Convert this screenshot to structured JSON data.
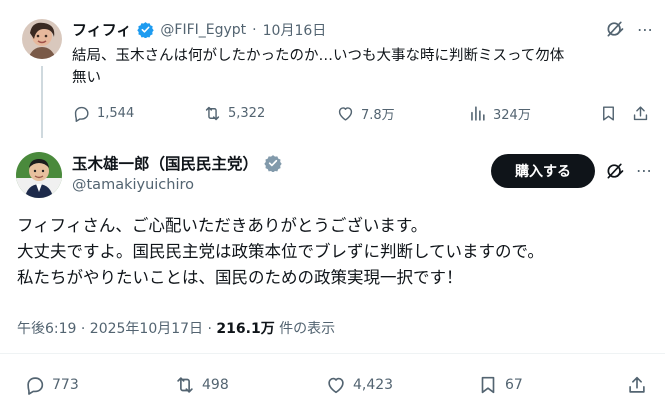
{
  "tweet1": {
    "name": "フィフィ",
    "handle": "@FIFI_Egypt",
    "sep": "·",
    "date": "10月16日",
    "text_line1": "結局、玉木さんは何がしたかったのか…いつも大事な時に判断ミスって勿体",
    "text_line2": "無い",
    "replies": "1,544",
    "reposts": "5,322",
    "likes": "7.8万",
    "views": "324万"
  },
  "tweet2": {
    "name": "玉木雄一郎（国民民主党）",
    "handle": "@tamakiyuichiro",
    "buy_label": "購入する",
    "body_line1": "フィフィさん、ご心配いただきありがとうございます。",
    "body_line2": "大丈夫ですよ。国民民主党は政策本位でブレずに判断していますので。",
    "body_line3": "私たちがやりたいことは、国民のための政策実現一択です！",
    "timestamp": "午後6:19 · 2025年10月17日 · ",
    "views_count": "216.1万",
    "views_label": " 件の表示",
    "replies": "773",
    "reposts": "498",
    "likes": "4,423",
    "bookmarks": "67"
  },
  "colors": {
    "verified_blue": "#1d9bf0",
    "verified_gray": "#829aab",
    "text": "#0f1419",
    "muted": "#536471"
  },
  "icons": [
    "verified-badge-icon",
    "grok-icon",
    "reply-icon",
    "repost-icon",
    "like-icon",
    "views-icon",
    "bookmark-icon",
    "share-icon"
  ]
}
